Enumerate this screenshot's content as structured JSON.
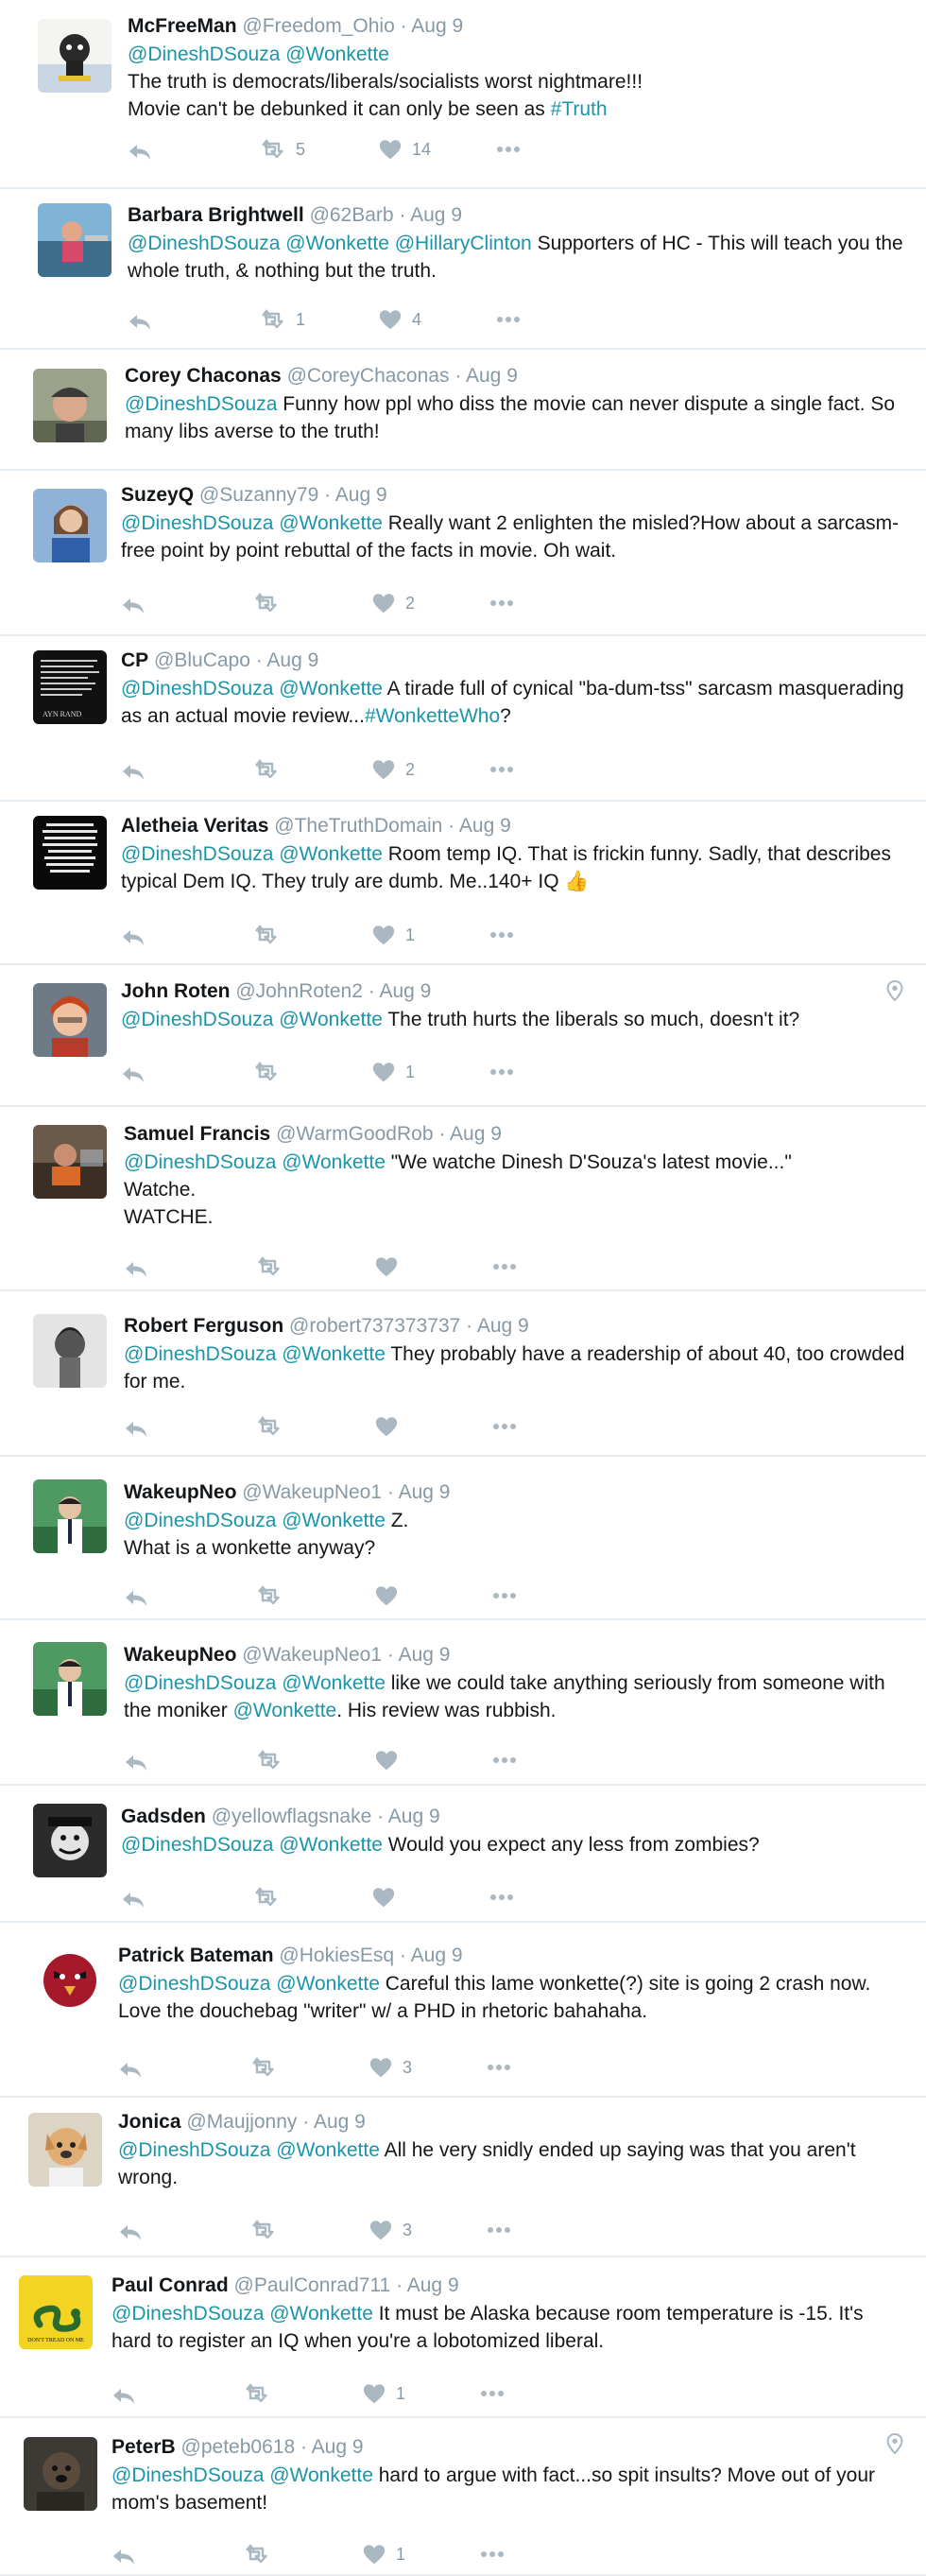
{
  "tweets": [
    {
      "id": "t1",
      "name": "McFreeMan",
      "handle": "@Freedom_Ohio",
      "date": "Aug 9",
      "segments": [
        {
          "t": "@DineshDSouza @Wonkette",
          "c": "mention"
        },
        {
          "t": "\nThe truth is democrats/liberals/socialists worst nightmare!!!\nMovie can't be debunked it can only be seen as "
        },
        {
          "t": "#Truth",
          "c": "hashtag"
        }
      ],
      "replies": "",
      "retweets": "5",
      "likes": "14",
      "avatar": "cartoon"
    },
    {
      "id": "t2",
      "name": "Barbara Brightwell",
      "handle": "@62Barb",
      "date": "Aug 9",
      "segments": [
        {
          "t": "@DineshDSouza @Wonkette @HillaryClinton",
          "c": "mention"
        },
        {
          "t": " Supporters of HC - This will teach you the whole truth, & nothing but the truth."
        }
      ],
      "replies": "",
      "retweets": "1",
      "likes": "4",
      "avatar": "boat"
    },
    {
      "id": "t3",
      "name": "Corey Chaconas",
      "handle": "@CoreyChaconas",
      "date": "Aug 9",
      "segments": [
        {
          "t": "@DineshDSouza",
          "c": "mention"
        },
        {
          "t": " Funny how ppl who diss the movie can never dispute a single fact. So many libs averse to the truth!"
        }
      ],
      "replies": "",
      "retweets": "",
      "likes": "",
      "avatar": "man-cap",
      "noActions": true
    },
    {
      "id": "t4",
      "name": "SuzeyQ",
      "handle": "@Suzanny79",
      "date": "Aug 9",
      "segments": [
        {
          "t": "@DineshDSouza @Wonkette",
          "c": "mention"
        },
        {
          "t": " Really want 2 enlighten the misled?How about a sarcasm-free point by point rebuttal of the facts in movie. Oh wait."
        }
      ],
      "replies": "",
      "retweets": "",
      "likes": "2",
      "avatar": "woman-blue"
    },
    {
      "id": "t5",
      "name": "CP",
      "handle": "@BluCapo",
      "date": "Aug 9",
      "segments": [
        {
          "t": "@DineshDSouza @Wonkette",
          "c": "mention"
        },
        {
          "t": " A tirade full of cynical \"ba-dum-tss\" sarcasm masquerading as an actual movie review..."
        },
        {
          "t": "#WonketteWho",
          "c": "hashtag"
        },
        {
          "t": "?"
        }
      ],
      "replies": "",
      "retweets": "",
      "likes": "2",
      "avatar": "quote-black",
      "avatarText": "AYN RAND"
    },
    {
      "id": "t6",
      "name": "Aletheia Veritas",
      "handle": "@TheTruthDomain",
      "date": "Aug 9",
      "segments": [
        {
          "t": "@DineshDSouza @Wonkette",
          "c": "mention"
        },
        {
          "t": " Room temp IQ.  That is frickin funny.  Sadly, that describes typical Dem IQ.  They truly are dumb.  Me..140+ IQ "
        }
      ],
      "emoji": "👍",
      "replies": "",
      "retweets": "",
      "likes": "1",
      "avatar": "quote-black2",
      "avatarText": "SOMETIMES PEOPLE DON'T WANT TO HEAR THE TRUTH BECAUSE THEY DON'T WANT THEIR ILLUSIONS DESTROYED"
    },
    {
      "id": "t7",
      "name": "John Roten",
      "handle": "@JohnRoten2",
      "date": "Aug 9",
      "segments": [
        {
          "t": "@DineshDSouza @Wonkette",
          "c": "mention"
        },
        {
          "t": " The truth hurts the liberals so much, doesn't it?"
        }
      ],
      "replies": "",
      "retweets": "",
      "likes": "1",
      "avatar": "redhair",
      "geo": true
    },
    {
      "id": "t8",
      "name": "Samuel Francis",
      "handle": "@WarmGoodRob",
      "date": "Aug 9",
      "segments": [
        {
          "t": "@DineshDSouza @Wonkette",
          "c": "mention"
        },
        {
          "t": " \"We watche Dinesh D'Souza's latest movie...\"\nWatche.\nWATCHE."
        }
      ],
      "replies": "",
      "retweets": "",
      "likes": "",
      "avatar": "car"
    },
    {
      "id": "t9",
      "name": "Robert Ferguson",
      "handle": "@robert737373737",
      "date": "Aug 9",
      "segments": [
        {
          "t": "@DineshDSouza @Wonkette",
          "c": "mention"
        },
        {
          "t": " They probably have a readership of about 40, too crowded for me."
        }
      ],
      "replies": "",
      "retweets": "",
      "likes": "",
      "avatar": "statue"
    },
    {
      "id": "t10",
      "name": "WakeupNeo",
      "handle": "@WakeupNeo1",
      "date": "Aug 9",
      "segments": [
        {
          "t": "@DineshDSouza @Wonkette",
          "c": "mention"
        },
        {
          "t": " Z.\n What is a wonkette anyway?"
        }
      ],
      "replies": "",
      "retweets": "",
      "likes": "",
      "avatar": "neo"
    },
    {
      "id": "t11",
      "name": "WakeupNeo",
      "handle": "@WakeupNeo1",
      "date": "Aug 9",
      "segments": [
        {
          "t": "@DineshDSouza @Wonkette",
          "c": "mention"
        },
        {
          "t": " like we could take anything seriously from someone with the moniker "
        },
        {
          "t": "@Wonkette",
          "c": "mention"
        },
        {
          "t": ". His review was rubbish."
        }
      ],
      "replies": "",
      "retweets": "",
      "likes": "",
      "avatar": "neo"
    },
    {
      "id": "t12",
      "name": "Gadsden",
      "handle": "@yellowflagsnake",
      "date": "Aug 9",
      "segments": [
        {
          "t": "@DineshDSouza @Wonkette",
          "c": "mention"
        },
        {
          "t": " Would you expect any less from zombies?"
        }
      ],
      "replies": "",
      "retweets": "",
      "likes": "",
      "avatar": "bw-face"
    },
    {
      "id": "t13",
      "name": "Patrick Bateman",
      "handle": "@HokiesEsq",
      "date": "Aug 9",
      "segments": [
        {
          "t": "@DineshDSouza @Wonkette",
          "c": "mention"
        },
        {
          "t": " Careful this lame wonkette(?) site is going 2 crash now. Love the douchebag \"writer\" w/ a PHD in rhetoric bahahaha."
        }
      ],
      "replies": "",
      "retweets": "",
      "likes": "3",
      "avatar": "bird"
    },
    {
      "id": "t14",
      "name": "Jonica",
      "handle": "@Maujjonny",
      "date": "Aug 9",
      "segments": [
        {
          "t": "@DineshDSouza @Wonkette",
          "c": "mention"
        },
        {
          "t": " All he very snidly ended up saying was that you aren't wrong."
        }
      ],
      "replies": "",
      "retweets": "",
      "likes": "3",
      "avatar": "dog"
    },
    {
      "id": "t15",
      "name": "Paul Conrad",
      "handle": "@PaulConrad711",
      "date": "Aug 9",
      "segments": [
        {
          "t": "@DineshDSouza @Wonkette",
          "c": "mention"
        },
        {
          "t": " It must be Alaska because room temperature is -15. It's hard to register an IQ when you're a lobotomized liberal."
        }
      ],
      "replies": "",
      "retweets": "",
      "likes": "1",
      "avatar": "gadsden",
      "avatarText": "DON'T TREAD ON ME"
    },
    {
      "id": "t16",
      "name": "PeterB",
      "handle": "@peteb0618",
      "date": "Aug 9",
      "segments": [
        {
          "t": "@DineshDSouza @Wonkette",
          "c": "mention"
        },
        {
          "t": " hard to argue with fact...so spit insults?  Move out of your mom's basement!"
        }
      ],
      "replies": "",
      "retweets": "",
      "likes": "1",
      "avatar": "dark-dog",
      "geo": true
    }
  ]
}
